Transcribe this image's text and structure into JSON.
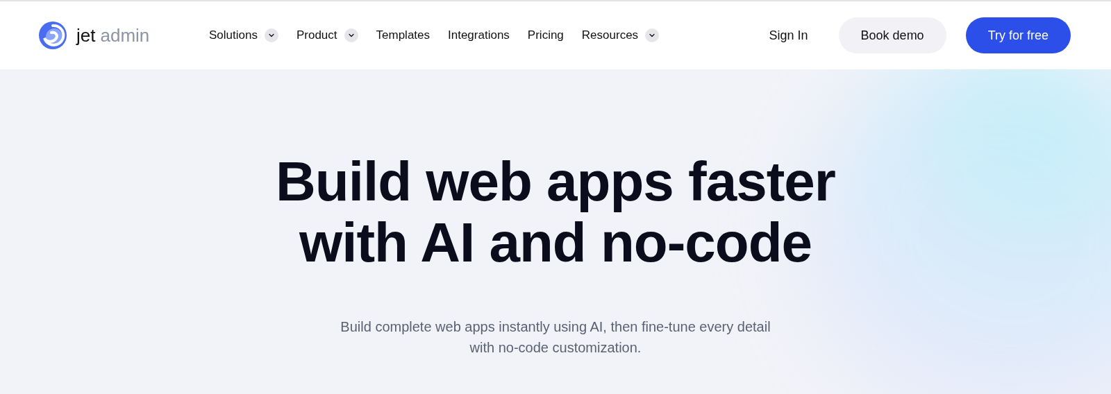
{
  "logo": {
    "word_1": "jet",
    "word_2": "admin"
  },
  "nav": [
    {
      "label": "Solutions",
      "has_menu": true
    },
    {
      "label": "Product",
      "has_menu": true
    },
    {
      "label": "Templates",
      "has_menu": false
    },
    {
      "label": "Integrations",
      "has_menu": false
    },
    {
      "label": "Pricing",
      "has_menu": false
    },
    {
      "label": "Resources",
      "has_menu": true
    }
  ],
  "actions": [
    {
      "label": "Sign In",
      "kind": "link"
    },
    {
      "label": "Book demo",
      "kind": "secondary"
    },
    {
      "label": "Try for free",
      "kind": "primary"
    }
  ],
  "hero": {
    "title_lines": [
      "Build web apps faster",
      "with AI and no-code"
    ],
    "subtitle": "Build complete web apps instantly using AI, then fine-tune every detail with no-code customization."
  }
}
